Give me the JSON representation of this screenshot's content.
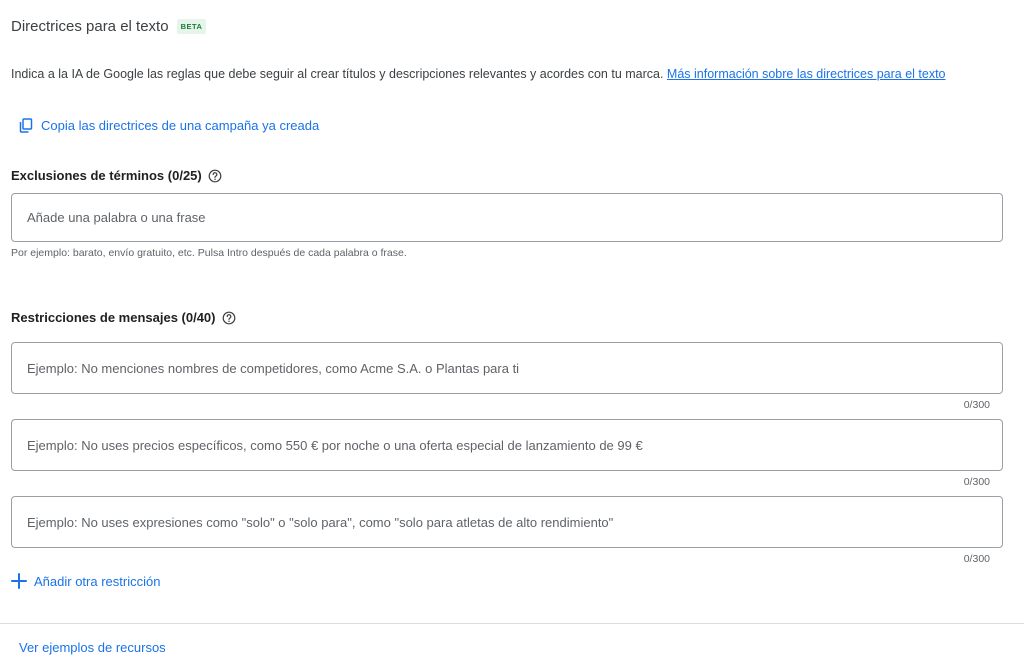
{
  "header": {
    "title": "Directrices para el texto",
    "badge": "BETA"
  },
  "description": {
    "text": "Indica a la IA de Google las reglas que debe seguir al crear títulos y descripciones relevantes y acordes con tu marca. ",
    "link": "Más información sobre las directrices para el texto"
  },
  "copy_link": {
    "label": "Copia las directrices de una campaña ya creada",
    "icon": "copy-icon"
  },
  "exclusions": {
    "label": "Exclusiones de términos (0/25)",
    "placeholder": "Añade una palabra o una frase",
    "value": "",
    "hint": "Por ejemplo: barato, envío gratuito, etc. Pulsa Intro después de cada palabra o frase."
  },
  "restrictions": {
    "label": "Restricciones de mensajes (0/40)",
    "fields": [
      {
        "placeholder": "Ejemplo: No menciones nombres de competidores, como Acme S.A. o Plantas para ti",
        "value": "",
        "counter": "0/300"
      },
      {
        "placeholder": "Ejemplo: No uses precios específicos, como 550 € por noche o una oferta especial de lanzamiento de 99 €",
        "value": "",
        "counter": "0/300"
      },
      {
        "placeholder": "Ejemplo: No uses expresiones como \"solo\" o \"solo para\", como \"solo para atletas de alto rendimiento\"",
        "value": "",
        "counter": "0/300"
      }
    ],
    "add_label": "Añadir otra restricción"
  },
  "footer": {
    "examples_link": "Ver ejemplos de recursos"
  },
  "colors": {
    "link": "#1a73e8",
    "beta_text": "#188038",
    "beta_bg": "#e6f4ea",
    "border": "#9aa0a6"
  }
}
